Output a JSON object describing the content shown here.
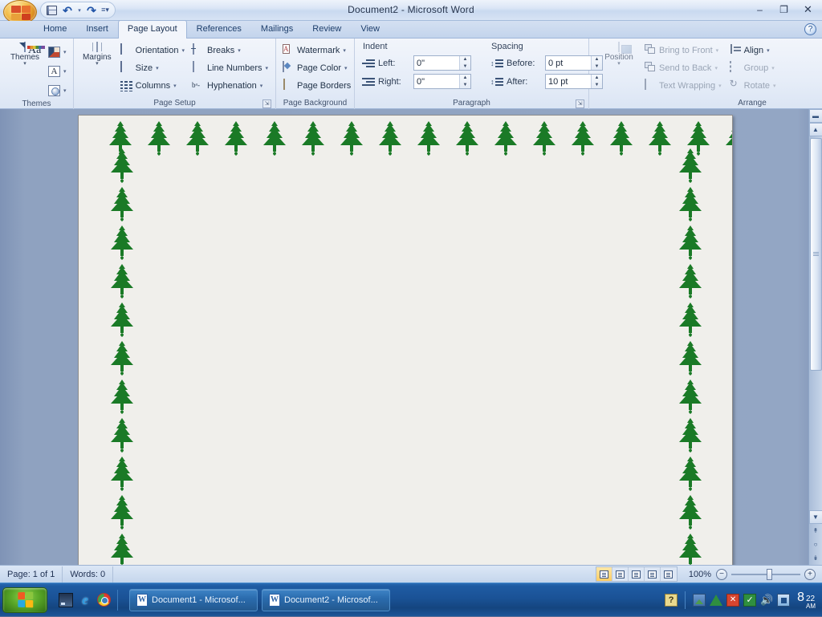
{
  "window": {
    "title": "Document2 - Microsoft Word",
    "minimize_label": "–",
    "restore_label": "❐",
    "close_label": "✕",
    "help_label": "?"
  },
  "quick_access": {
    "office_button": "office-button",
    "save_label": "Save",
    "undo_label": "Undo",
    "redo_label": "Redo",
    "customize_label": "Customize Quick Access Toolbar"
  },
  "tabs": [
    {
      "label": "Home",
      "active": false
    },
    {
      "label": "Insert",
      "active": false
    },
    {
      "label": "Page Layout",
      "active": true
    },
    {
      "label": "References",
      "active": false
    },
    {
      "label": "Mailings",
      "active": false
    },
    {
      "label": "Review",
      "active": false
    },
    {
      "label": "View",
      "active": false
    }
  ],
  "ribbon": {
    "groups": [
      {
        "name": "Themes",
        "label": "Themes",
        "big_button": {
          "label": "Themes",
          "caret": "▾"
        },
        "small_buttons": [
          {
            "label": "",
            "name": "theme-colors",
            "caret": "▾"
          },
          {
            "label": "",
            "name": "theme-fonts",
            "caret": "▾"
          },
          {
            "label": "",
            "name": "theme-effects",
            "caret": "▾"
          }
        ]
      },
      {
        "name": "Page Setup",
        "label": "Page Setup",
        "big_button": {
          "label": "Margins",
          "caret": "▾"
        },
        "col1": [
          {
            "label": "Orientation",
            "caret": "▾"
          },
          {
            "label": "Size",
            "caret": "▾"
          },
          {
            "label": "Columns",
            "caret": "▾"
          }
        ],
        "col2": [
          {
            "label": "Breaks",
            "caret": "▾"
          },
          {
            "label": "Line Numbers",
            "caret": "▾"
          },
          {
            "label": "Hyphenation",
            "caret": "▾"
          }
        ],
        "has_dialog_launcher": true
      },
      {
        "name": "Page Background",
        "label": "Page Background",
        "items": [
          {
            "label": "Watermark",
            "caret": "▾"
          },
          {
            "label": "Page Color",
            "caret": "▾"
          },
          {
            "label": "Page Borders",
            "caret": ""
          }
        ]
      },
      {
        "name": "Paragraph",
        "label": "Paragraph",
        "indent": {
          "heading": "Indent",
          "left_label": "Left:",
          "left_value": "0\"",
          "right_label": "Right:",
          "right_value": "0\""
        },
        "spacing": {
          "heading": "Spacing",
          "before_label": "Before:",
          "before_value": "0 pt",
          "after_label": "After:",
          "after_value": "10 pt"
        },
        "has_dialog_launcher": true
      },
      {
        "name": "Arrange",
        "label": "Arrange",
        "big_button": {
          "label": "Position",
          "caret": "▾"
        },
        "col1": [
          {
            "label": "Bring to Front",
            "caret": "▾",
            "disabled": true
          },
          {
            "label": "Send to Back",
            "caret": "▾",
            "disabled": true
          },
          {
            "label": "Text Wrapping",
            "caret": "▾",
            "disabled": true
          }
        ],
        "col2": [
          {
            "label": "Align",
            "caret": "▾",
            "disabled": true
          },
          {
            "label": "Group",
            "caret": "▾",
            "disabled": true
          },
          {
            "label": "Rotate",
            "caret": "▾",
            "disabled": true
          }
        ]
      }
    ]
  },
  "document": {
    "border_art": "christmas-tree-border",
    "border_color": "#1a7a26",
    "page_color": "#f0efeb",
    "top_trees": 17,
    "side_trees": 12
  },
  "status_bar": {
    "page_label": "Page: 1 of 1",
    "words_label": "Words: 0",
    "zoom_value": "100%",
    "zoom_out_label": "−",
    "zoom_in_label": "+",
    "view_buttons": [
      {
        "name": "print-layout-view",
        "active": true
      },
      {
        "name": "full-screen-reading-view",
        "active": false
      },
      {
        "name": "web-layout-view",
        "active": false
      },
      {
        "name": "outline-view",
        "active": false
      },
      {
        "name": "draft-view",
        "active": false
      }
    ]
  },
  "taskbar": {
    "start_label": "Start",
    "quick_launch": [
      {
        "name": "show-desktop-icon"
      },
      {
        "name": "internet-explorer-icon",
        "glyph": "e"
      },
      {
        "name": "google-chrome-icon"
      }
    ],
    "tasks": [
      {
        "label": "Document1 - Microsof...",
        "active": false
      },
      {
        "label": "Document2 - Microsof...",
        "active": true
      }
    ],
    "tray": [
      {
        "name": "help-tray-icon",
        "glyph": "?"
      },
      {
        "name": "picture-tray-icon"
      },
      {
        "name": "green-triangle-tray-icon"
      },
      {
        "name": "red-error-tray-icon"
      },
      {
        "name": "green-check-tray-icon"
      },
      {
        "name": "volume-tray-icon",
        "glyph": "🔊"
      },
      {
        "name": "network-tray-icon"
      }
    ],
    "clock": {
      "hour": "8",
      "minute": "22",
      "meridiem": "AM"
    }
  }
}
